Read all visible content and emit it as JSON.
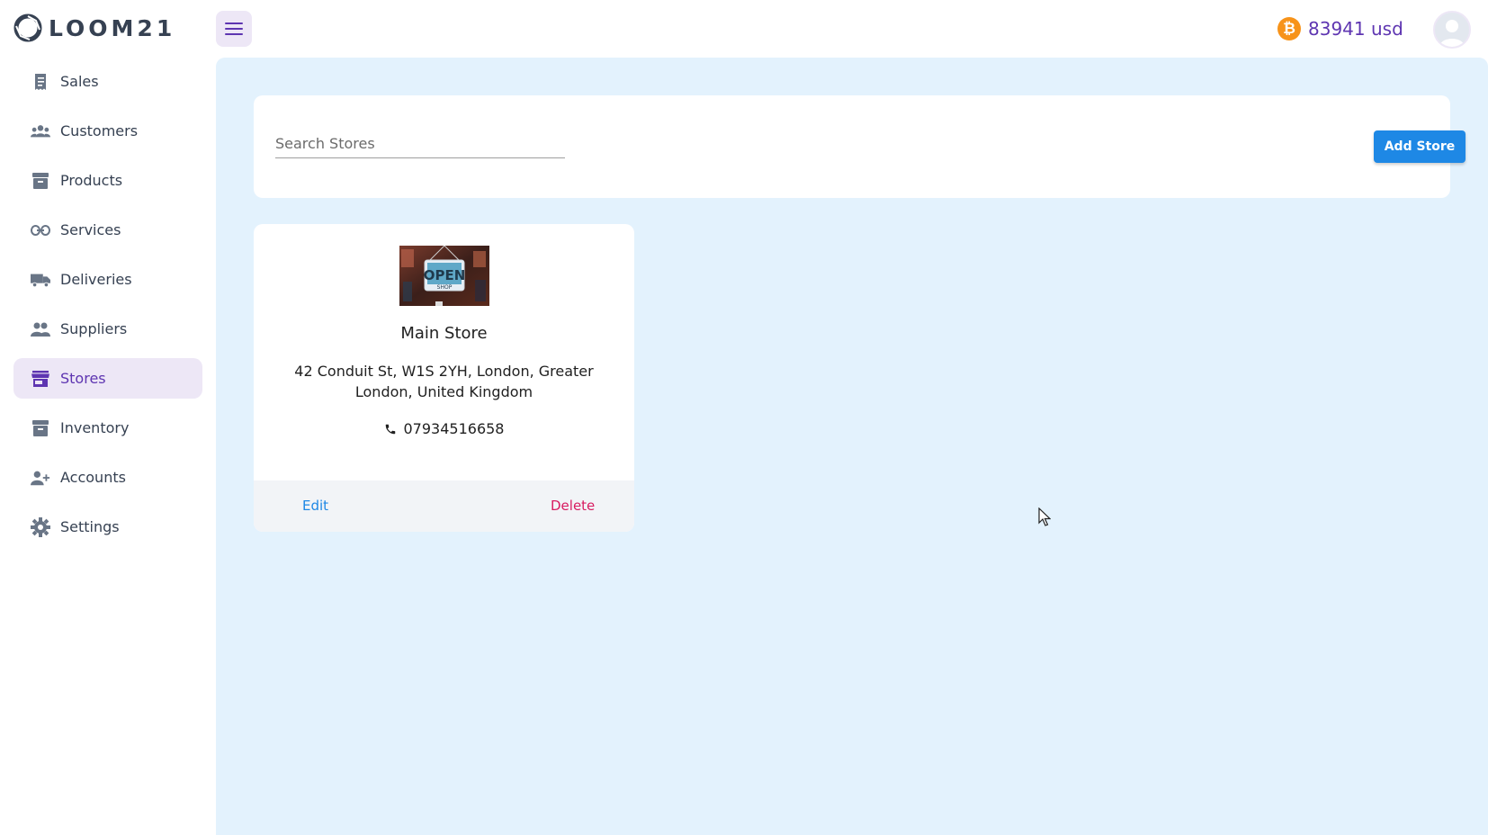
{
  "app": {
    "logo_text": "LOOM21"
  },
  "header": {
    "balance": "83941 usd",
    "currency_icon": "bitcoin-icon",
    "accent_color": "#5e35b1"
  },
  "sidebar": {
    "items": [
      {
        "label": "Sales",
        "icon": "receipt-icon"
      },
      {
        "label": "Customers",
        "icon": "group-icon"
      },
      {
        "label": "Products",
        "icon": "archive-box-icon"
      },
      {
        "label": "Services",
        "icon": "link-icon"
      },
      {
        "label": "Deliveries",
        "icon": "truck-icon"
      },
      {
        "label": "Suppliers",
        "icon": "people-icon"
      },
      {
        "label": "Stores",
        "icon": "store-icon",
        "active": true
      },
      {
        "label": "Inventory",
        "icon": "archive-box-icon"
      },
      {
        "label": "Accounts",
        "icon": "add-user-icon"
      },
      {
        "label": "Settings",
        "icon": "gear-icon"
      }
    ]
  },
  "search": {
    "placeholder": "Search Stores",
    "value": ""
  },
  "toolbar": {
    "add_label": "Add Store"
  },
  "stores": [
    {
      "name": "Main Store",
      "address": "42 Conduit St, W1S 2YH, London, Greater London, United Kingdom",
      "phone": "07934516658",
      "image_sign_text": "OPEN",
      "image_sub_text": "SHOP",
      "edit_label": "Edit",
      "delete_label": "Delete"
    }
  ],
  "colors": {
    "primary": "#1e88e5",
    "danger": "#d81b60",
    "main_bg": "#e3f2fd",
    "active_bg": "#ede7f6"
  }
}
